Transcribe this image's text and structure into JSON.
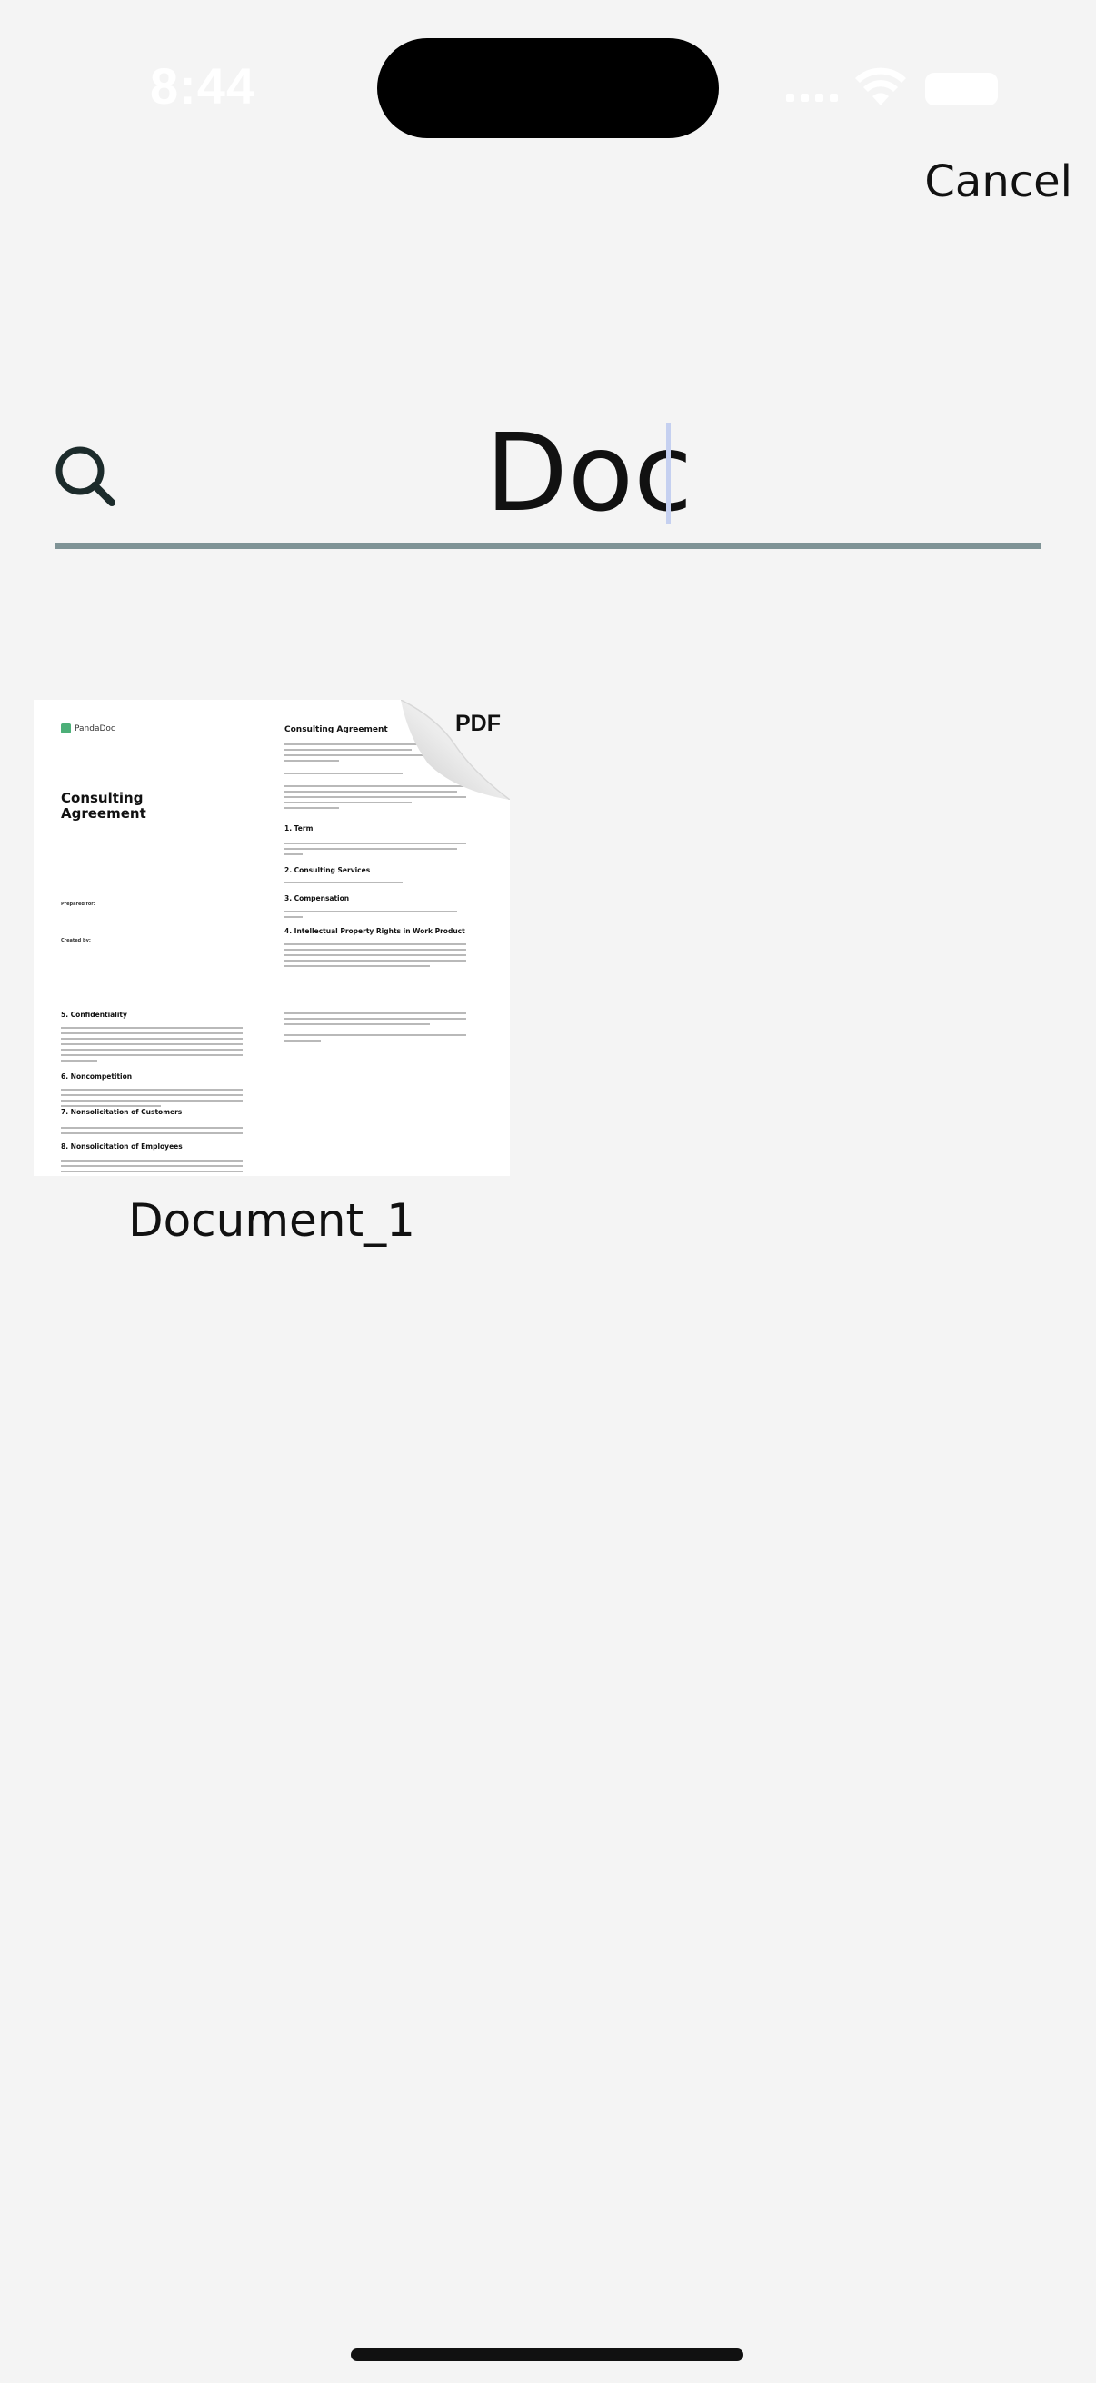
{
  "status_bar": {
    "time": "8:44"
  },
  "header": {
    "cancel_label": "Cancel"
  },
  "search": {
    "query": "Doc",
    "icon": "search-icon"
  },
  "results": [
    {
      "name": "Document_1",
      "badge": "PDF",
      "thumbnail": {
        "logo_text": "PandaDoc",
        "cover_title": "Consulting Agreement",
        "prepared_for": "Prepared for:",
        "created_by": "Created by:",
        "right_title": "Consulting Agreement",
        "right_sections": [
          "1. Term",
          "2. Consulting Services",
          "3. Compensation",
          "4. Intellectual Property Rights in Work Product"
        ],
        "left_sections": [
          "5. Confidentiality",
          "6. Noncompetition",
          "7. Nonsolicitation of Customers",
          "8. Nonsolicitation of Employees"
        ]
      }
    }
  ],
  "colors": {
    "underline": "#7f9396",
    "caret": "#c5d0f0",
    "background": "#f4f4f4"
  }
}
